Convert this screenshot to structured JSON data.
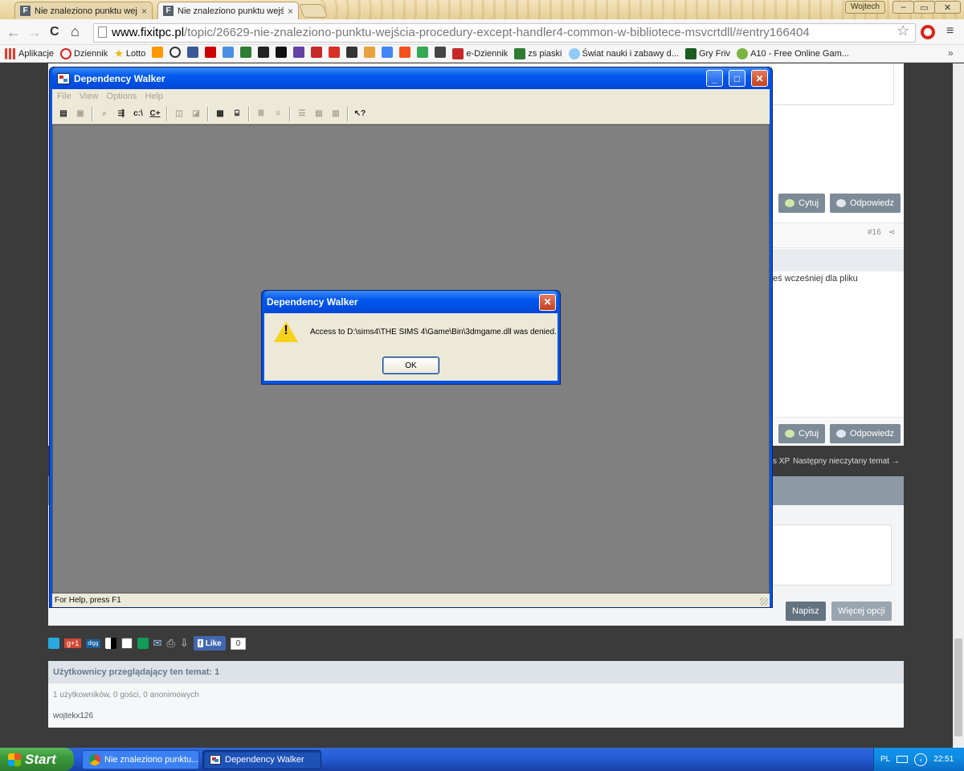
{
  "browser": {
    "tabs": [
      {
        "favicon": "F",
        "title": "Nie znaleziono punktu wejści"
      },
      {
        "favicon": "F",
        "title": "Nie znaleziono punktu wejści"
      }
    ],
    "tab_close": "×",
    "user": "Wojtech",
    "window_buttons": [
      "–",
      "▭",
      "✕"
    ],
    "back": "←",
    "forward": "→",
    "reload": "C",
    "home": "⌂",
    "url_host": "www.fixitpc.pl",
    "url_path": "/topic/26629-nie-znaleziono-punktu-wejścia-procedury-except-handler4-common-w-bibliotece-msvcrtdll/#entry166404",
    "bookmarks": [
      {
        "label": "Aplikacje",
        "color": "#e23c2d"
      },
      {
        "label": "Dziennik",
        "color": "#d8231b"
      },
      {
        "label": "Lotto",
        "color": "#f4b400"
      },
      {
        "label": "",
        "color": "#ff9900"
      },
      {
        "label": "",
        "color": "#333333"
      },
      {
        "label": "",
        "color": "#3b5998"
      },
      {
        "label": "",
        "color": "#cc0000"
      },
      {
        "label": "",
        "color": "#4a90e2"
      },
      {
        "label": "",
        "color": "#2e7d32"
      },
      {
        "label": "",
        "color": "#222222"
      },
      {
        "label": "",
        "color": "#111111"
      },
      {
        "label": "",
        "color": "#6441a5"
      },
      {
        "label": "",
        "color": "#c62828"
      },
      {
        "label": "",
        "color": "#d93025"
      },
      {
        "label": "",
        "color": "#333333"
      },
      {
        "label": "",
        "color": "#e6a23c"
      },
      {
        "label": "",
        "color": "#4285f4"
      },
      {
        "label": "",
        "color": "#f4511e"
      },
      {
        "label": "",
        "color": "#34a853"
      },
      {
        "label": "",
        "color": "#444444"
      },
      {
        "label": "e-Dziennik",
        "color": "#c62828"
      },
      {
        "label": "zs piaski",
        "color": "#2e7d32"
      },
      {
        "label": "Świat nauki i zabawy d...",
        "color": "#90caf9"
      },
      {
        "label": "Gry Friv",
        "color": "#1b5e20"
      },
      {
        "label": "A10 - Free Online Gam...",
        "color": "#7cb342"
      }
    ],
    "more": "»"
  },
  "forum": {
    "quote_label": "Cytuj",
    "reply_label": "Odpowiedz",
    "post_number": "#16",
    "snippet": "eś wcześniej dla pliku",
    "topic_nav_left": "s XP",
    "topic_nav": "Następny nieczytany temat →",
    "write_button": "Napisz",
    "more_options_button": "Więcej opcji",
    "share_icons": [
      "t",
      "g+1",
      "digg",
      "del",
      "su",
      "st",
      "✉",
      "⎙",
      "⇩"
    ],
    "fb_like": "Like",
    "fb_count": "0",
    "viewers_title": "Użytkownicy przeglądający ten temat: 1",
    "viewers_counts": "1 użytkowników, 0 gości, 0 anonimowych",
    "viewer_name": "wojtekx126"
  },
  "depwalker": {
    "title": "Dependency Walker",
    "menu": [
      "File",
      "View",
      "Options",
      "Help"
    ],
    "status": "For Help, press F1",
    "tools": [
      "📂",
      "💾",
      "|",
      "🔍",
      "⇶",
      "c:\\",
      "C+",
      "|",
      "⚙",
      "⚙",
      "|",
      "🖥",
      "🔎",
      "|",
      "≡",
      "≡",
      "|",
      "☰",
      "☰",
      "▥",
      "|",
      "?"
    ]
  },
  "dialog": {
    "title": "Dependency Walker",
    "message": "Access to D:\\sims4\\THE SIMS 4\\Game\\Bin\\3dmgame.dll was denied.",
    "ok": "OK",
    "close": "✕"
  },
  "taskbar": {
    "start": "Start",
    "items": [
      "Nie znaleziono punktu...",
      "Dependency Walker"
    ],
    "lang": "PL",
    "time": "22:51"
  }
}
